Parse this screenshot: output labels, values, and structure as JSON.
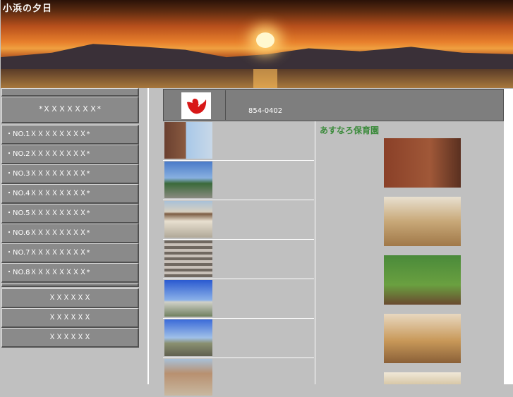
{
  "banner": {
    "title": "小浜の夕日"
  },
  "sidebar": {
    "header_label": "*ＸＸＸＸＸＸＸ*",
    "items": [
      "・NO.1ＸＸＸＸＸＸＸＸ*",
      "・NO.2ＸＸＸＸＸＸＸＸ*",
      "・NO.3ＸＸＸＸＸＸＸＸ*",
      "・NO.4ＸＸＸＸＸＸＸＸ*",
      "・NO.5ＸＸＸＸＸＸＸＸ*",
      "・NO.6ＸＸＸＸＸＸＸＸ*",
      "・NO.7ＸＸＸＸＸＸＸＸ*",
      "・NO.8ＸＸＸＸＸＸＸＸ*"
    ],
    "footer_items": [
      "ＸＸＸＸＸＸ",
      "ＸＸＸＸＸＸ",
      "ＸＸＸＸＸＸ"
    ]
  },
  "content": {
    "postal_code": "854-0402",
    "facility_name": "あすなろ保育園"
  },
  "colors": {
    "accent_green": "#3a8a3a",
    "logo_red": "#d81818",
    "panel_gray": "#7e7e7e"
  }
}
